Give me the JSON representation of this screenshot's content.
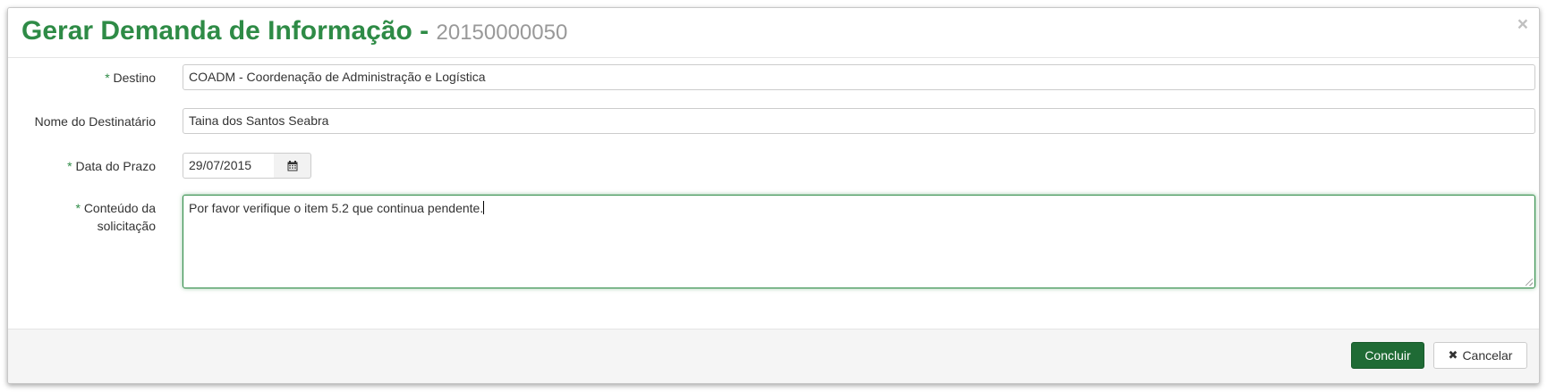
{
  "modal": {
    "title": "Gerar Demanda de Informação -",
    "number": "20150000050",
    "close_symbol": "×"
  },
  "form": {
    "required_mark": "*",
    "destino": {
      "label": "Destino",
      "value": "COADM - Coordenação de Administração e Logística"
    },
    "nome_destinatario": {
      "label": "Nome do Destinatário",
      "value": "Taina dos Santos Seabra"
    },
    "data_prazo": {
      "label": "Data do Prazo",
      "value": "29/07/2015",
      "calendar_icon": "calendar-icon"
    },
    "conteudo": {
      "label_line1": "Conteúdo da",
      "label_line2": "solicitação",
      "value": "Por favor verifique o item 5.2 que continua pendente."
    }
  },
  "footer": {
    "concluir_label": "Concluir",
    "cancelar_label": "Cancelar",
    "cancelar_icon_symbol": "✖"
  },
  "colors": {
    "brand_green": "#2e8b46",
    "primary_button": "#1f6b35",
    "muted_gray": "#999999"
  }
}
